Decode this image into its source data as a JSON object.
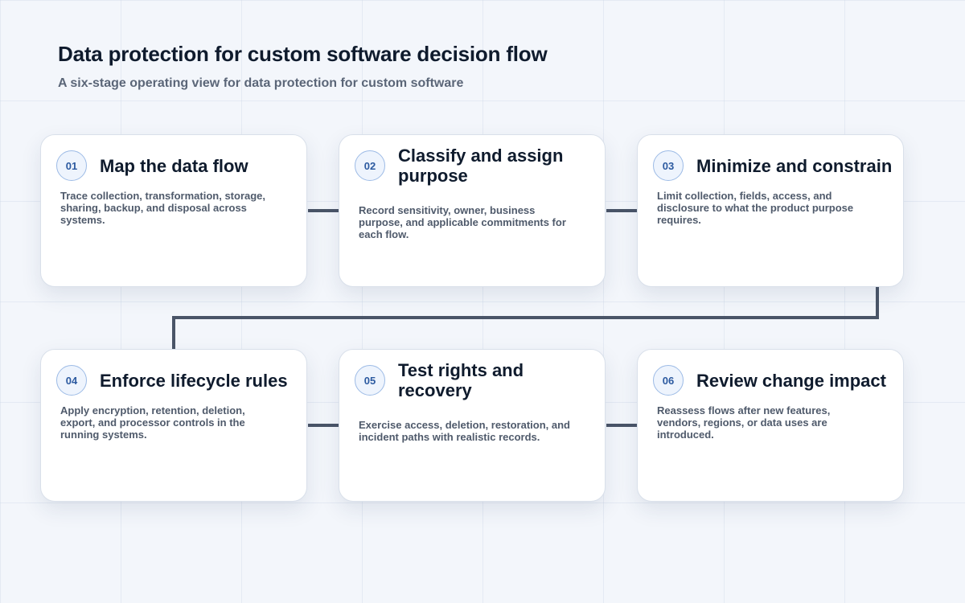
{
  "header": {
    "title": "Data protection for custom software decision flow",
    "subtitle": "A six-stage operating view for data protection for custom software"
  },
  "stages": [
    {
      "number": "01",
      "title": "Map the data flow",
      "description": "Trace collection, transformation, storage, sharing, backup, and disposal across systems."
    },
    {
      "number": "02",
      "title": "Classify and assign purpose",
      "description": "Record sensitivity, owner, business purpose, and applicable commitments for each flow."
    },
    {
      "number": "03",
      "title": "Minimize and constrain",
      "description": "Limit collection, fields, access, and disclosure to what the product purpose requires."
    },
    {
      "number": "04",
      "title": "Enforce lifecycle rules",
      "description": "Apply encryption, retention, deletion, export, and processor controls in the running systems."
    },
    {
      "number": "05",
      "title": "Test rights and recovery",
      "description": "Exercise access, deletion, restoration, and incident paths with realistic records."
    },
    {
      "number": "06",
      "title": "Review change impact",
      "description": "Reassess flows after new features, vendors, regions, or data uses are introduced."
    }
  ],
  "colors": {
    "connector": "#4a5568",
    "badge_text": "#2c5aa0",
    "badge_border": "#9dbbe6",
    "title_text": "#0f1b2d",
    "body_text": "#4f5a6b"
  }
}
